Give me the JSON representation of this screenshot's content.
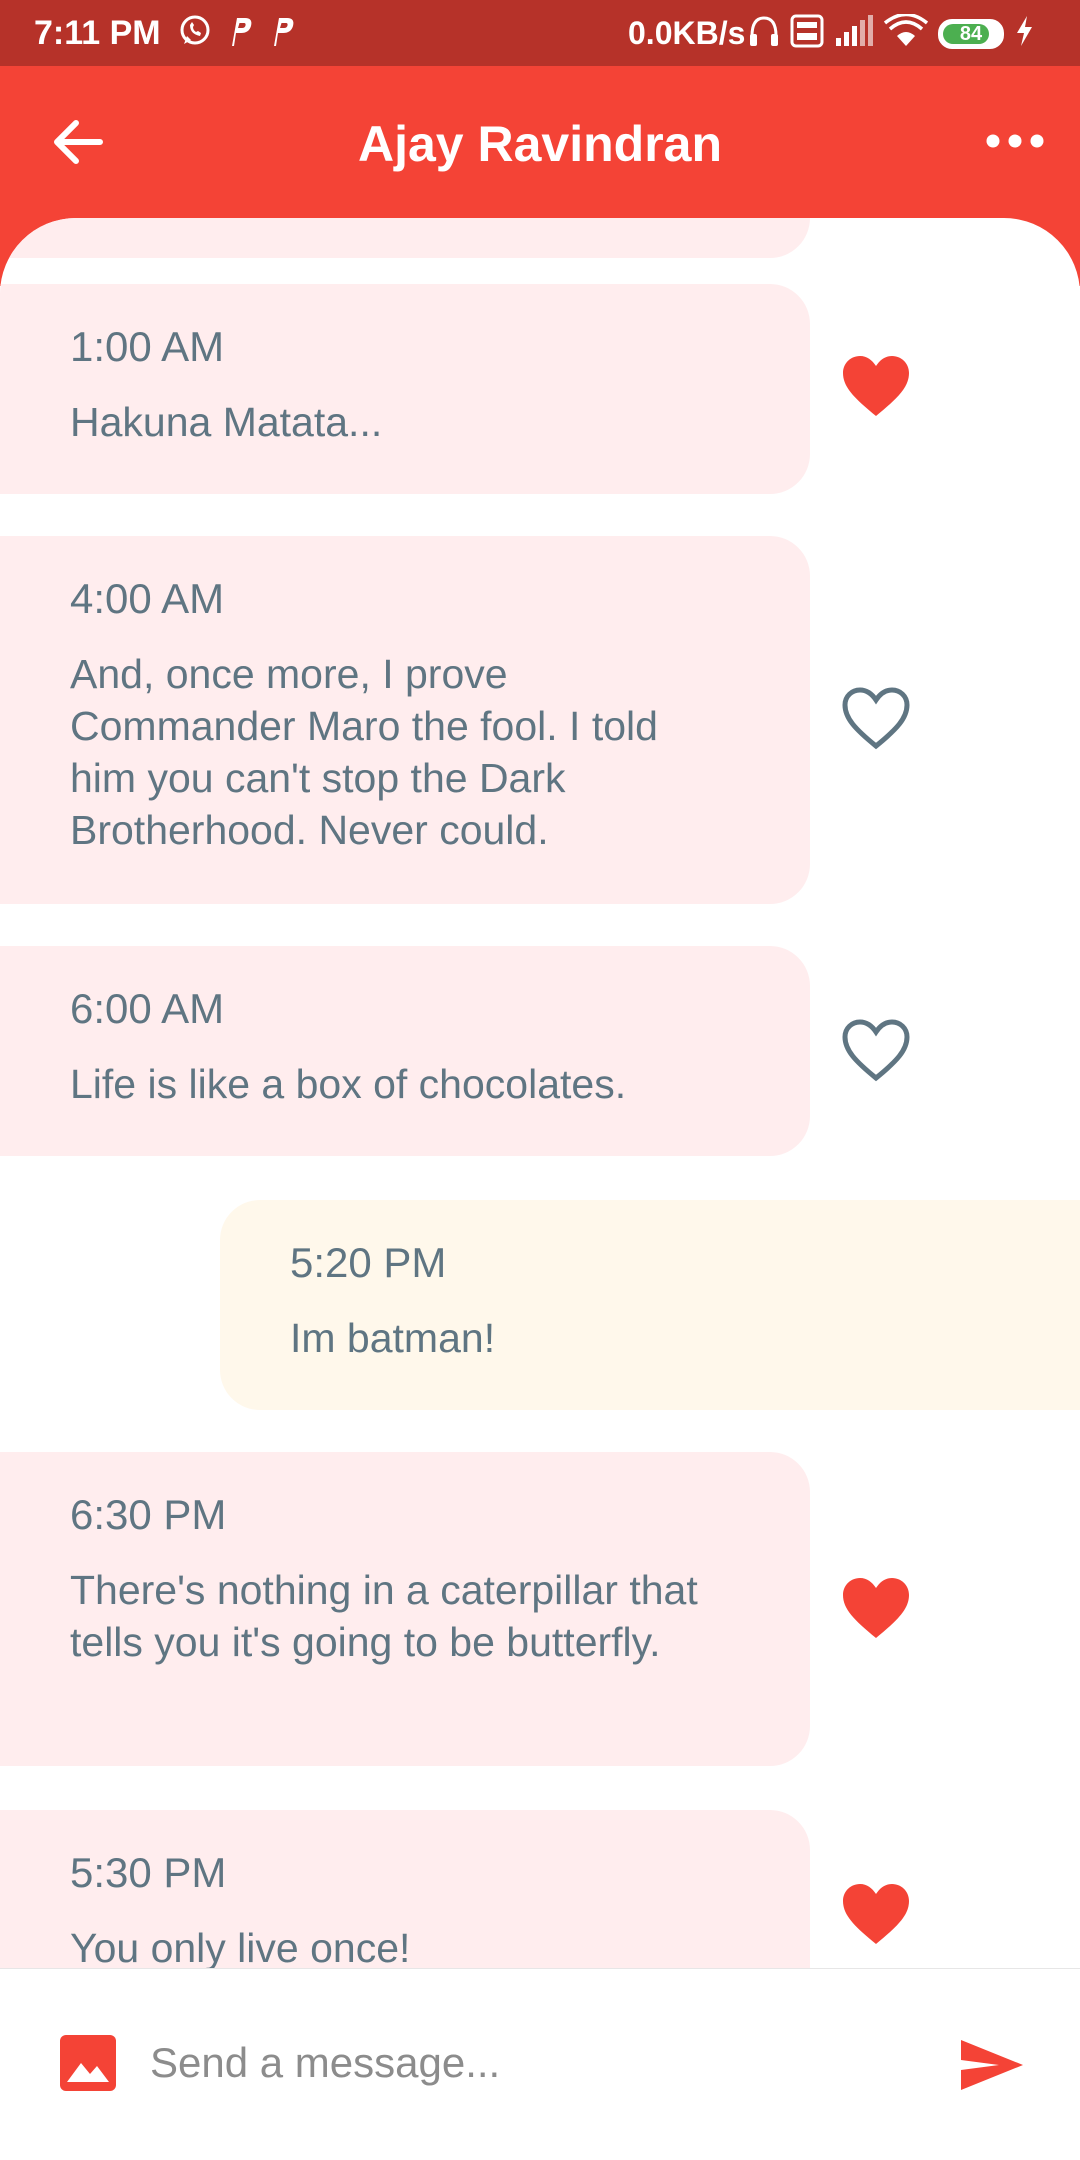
{
  "status_bar": {
    "time": "7:11 PM",
    "net_speed": "0.0KB/s",
    "battery_level": "84",
    "battery_fraction": 0.84,
    "left_icons": [
      "whatsapp-icon",
      "p-app-icon",
      "p-app-icon"
    ],
    "right_icons": [
      "headset-icon",
      "volte-icon",
      "signal-icon",
      "wifi-icon",
      "battery-icon",
      "charging-icon"
    ]
  },
  "header": {
    "title": "Ajay Ravindran",
    "back_icon": "arrow-left-icon",
    "menu_icon": "more-dots-icon"
  },
  "messages": [
    {
      "direction": "received",
      "time": "1:00 AM",
      "text": "Hakuna Matata...",
      "liked": true
    },
    {
      "direction": "received",
      "time": "4:00 AM",
      "text": "And, once more, I prove Commander Maro the fool. I told him you can't stop the Dark Brotherhood. Never could.",
      "liked": false
    },
    {
      "direction": "received",
      "time": "6:00 AM",
      "text": "Life is like a box of chocolates.",
      "liked": false
    },
    {
      "direction": "sent",
      "time": "5:20 PM",
      "text": "Im batman!"
    },
    {
      "direction": "received",
      "time": "6:30 PM",
      "text": "There's nothing in a caterpillar that tells you it's going to be butterfly.",
      "liked": true
    },
    {
      "direction": "received",
      "time": "5:30 PM",
      "text": "You only live once!",
      "liked": true
    }
  ],
  "composer": {
    "placeholder": "Send a message...",
    "value": "",
    "image_icon": "image-icon",
    "send_icon": "send-icon"
  },
  "colors": {
    "status_bar": "#B63229",
    "header": "#F44336",
    "received_bubble": "#FFEDEE",
    "sent_bubble": "#FFF8EB",
    "message_text": "#5F7582",
    "heart_liked": "#F44336",
    "heart_unliked": "#5F7582"
  }
}
